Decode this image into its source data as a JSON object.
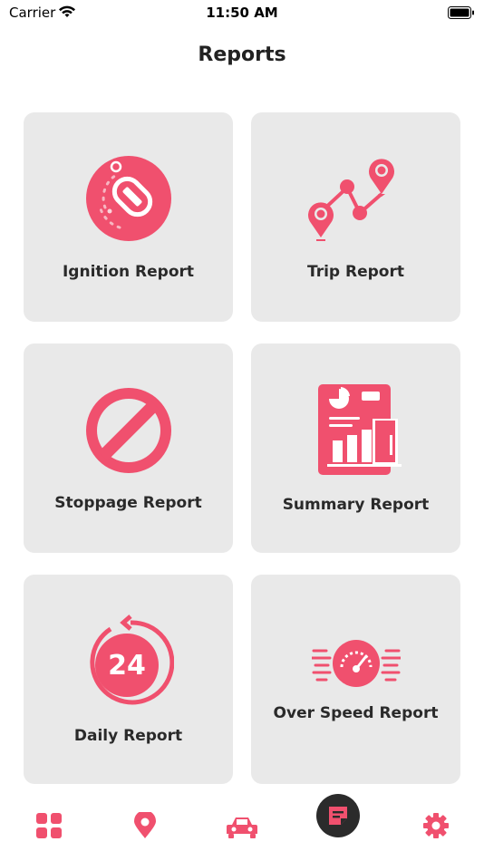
{
  "status_bar": {
    "carrier": "Carrier",
    "time": "11:50 AM"
  },
  "header": {
    "title": "Reports"
  },
  "colors": {
    "accent": "#f0506e",
    "card_bg": "#e9e9e9",
    "active_tab_bg": "#2b2b2b"
  },
  "reports": [
    {
      "label": "Ignition Report",
      "icon": "ignition-icon"
    },
    {
      "label": "Trip Report",
      "icon": "trip-route-icon"
    },
    {
      "label": "Stoppage Report",
      "icon": "stop-sign-icon"
    },
    {
      "label": "Summary Report",
      "icon": "summary-chart-icon"
    },
    {
      "label": "Daily Report",
      "icon": "daily-24-icon",
      "badge": "24"
    },
    {
      "label": "Over Speed Report",
      "icon": "speedometer-icon"
    }
  ],
  "tabs": [
    {
      "name": "dashboard",
      "icon": "dashboard-grid-icon"
    },
    {
      "name": "location",
      "icon": "location-pin-icon"
    },
    {
      "name": "vehicles",
      "icon": "car-icon"
    },
    {
      "name": "reports",
      "icon": "report-note-icon",
      "active": true
    },
    {
      "name": "settings",
      "icon": "gear-icon"
    }
  ]
}
